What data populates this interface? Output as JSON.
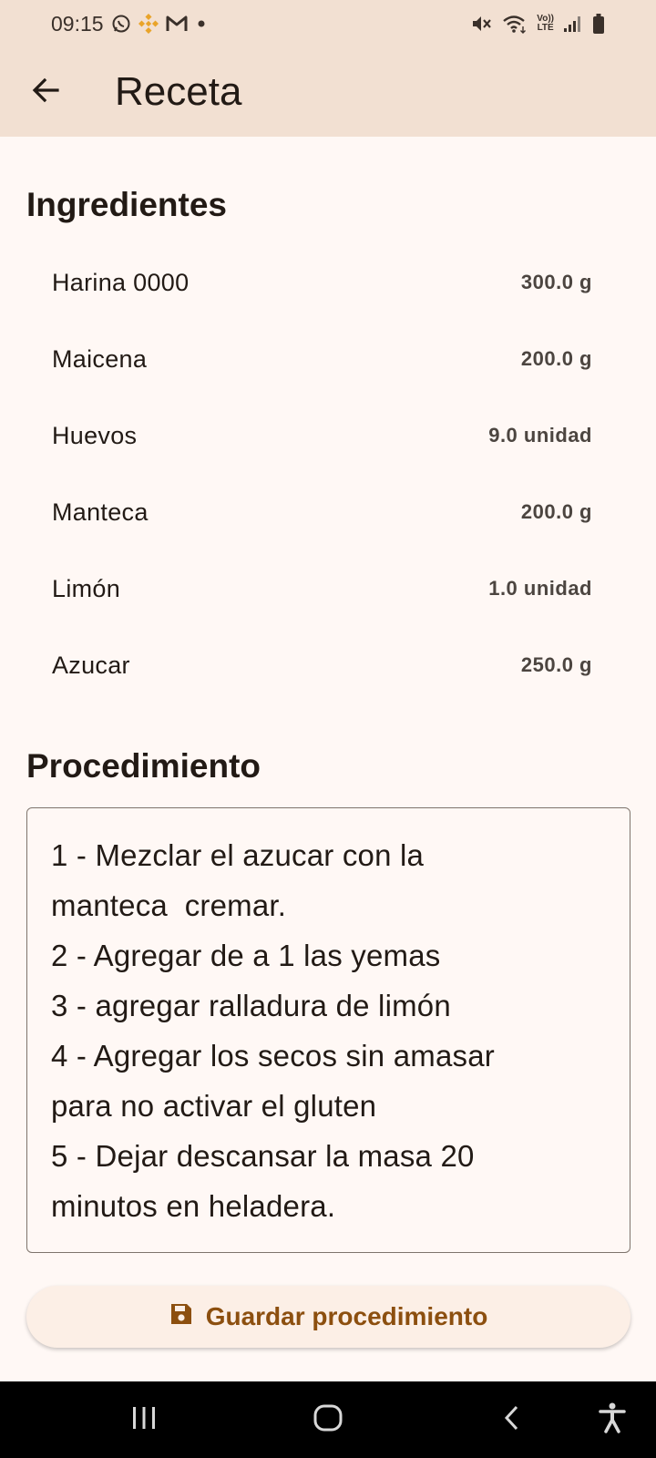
{
  "status_bar": {
    "time": "09:15",
    "left_icons": [
      "whatsapp-icon",
      "binance-icon",
      "gmail-icon",
      "dot-icon"
    ],
    "right_icons": [
      "mute-icon",
      "wifi-icon",
      "volte-icon",
      "signal-icon",
      "battery-icon"
    ],
    "volte_label_top": "Vo))",
    "volte_label_bottom": "LTE"
  },
  "app_bar": {
    "back_icon": "arrow-left-icon",
    "title": "Receta"
  },
  "ingredients": {
    "heading": "Ingredientes",
    "items": [
      {
        "name": "Harina 0000",
        "quantity": "300.0 g"
      },
      {
        "name": "Maicena",
        "quantity": "200.0 g"
      },
      {
        "name": "Huevos",
        "quantity": "9.0 unidad"
      },
      {
        "name": "Manteca",
        "quantity": "200.0 g"
      },
      {
        "name": "Limón",
        "quantity": "1.0 unidad"
      },
      {
        "name": "Azucar",
        "quantity": "250.0 g"
      }
    ]
  },
  "procedure": {
    "heading": "Procedimiento",
    "text": "1 - Mezclar el azucar con la\nmanteca  cremar.\n2 - Agregar de a 1 las yemas\n3 - agregar ralladura de limón\n4 - Agregar los secos sin amasar\npara no activar el gluten\n5 - Dejar descansar la masa 20\nminutos en heladera."
  },
  "save_button": {
    "icon": "save-icon",
    "label": "Guardar procedimiento"
  },
  "nav_bar": {
    "items": [
      "recents-icon",
      "home-icon",
      "back-icon",
      "accessibility-icon"
    ]
  },
  "colors": {
    "app_bar_bg": "#f2e0d2",
    "page_bg": "#fff8f5",
    "accent": "#8c4f0f",
    "button_bg": "#fcefe6"
  }
}
